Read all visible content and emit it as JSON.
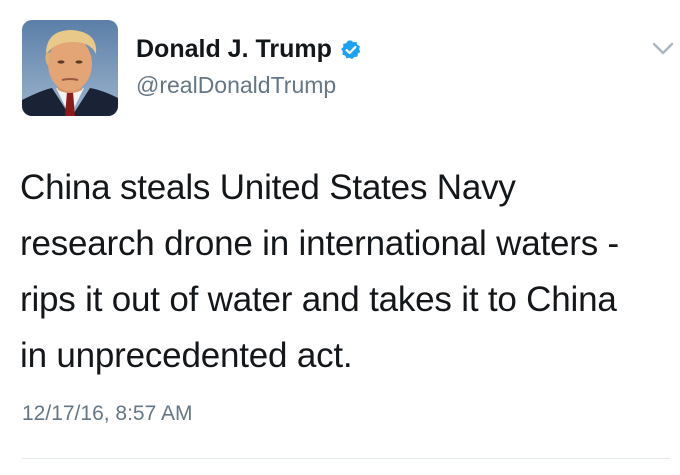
{
  "tweet": {
    "author": {
      "display_name": "Donald J. Trump",
      "handle": "@realDonaldTrump",
      "verified": true
    },
    "text_lines": [
      "China steals United States Navy",
      "research drone in international waters -",
      "rips it out of water and takes it to China",
      "in unprecedented act."
    ],
    "timestamp": "12/17/16, 8:57 AM"
  },
  "icons": {
    "verified": "verified-badge-icon",
    "menu": "chevron-down-icon"
  },
  "colors": {
    "verified_blue": "#1da1f2",
    "secondary_text": "#657786",
    "primary_text": "#14171a",
    "divider": "#e1e8ed"
  }
}
